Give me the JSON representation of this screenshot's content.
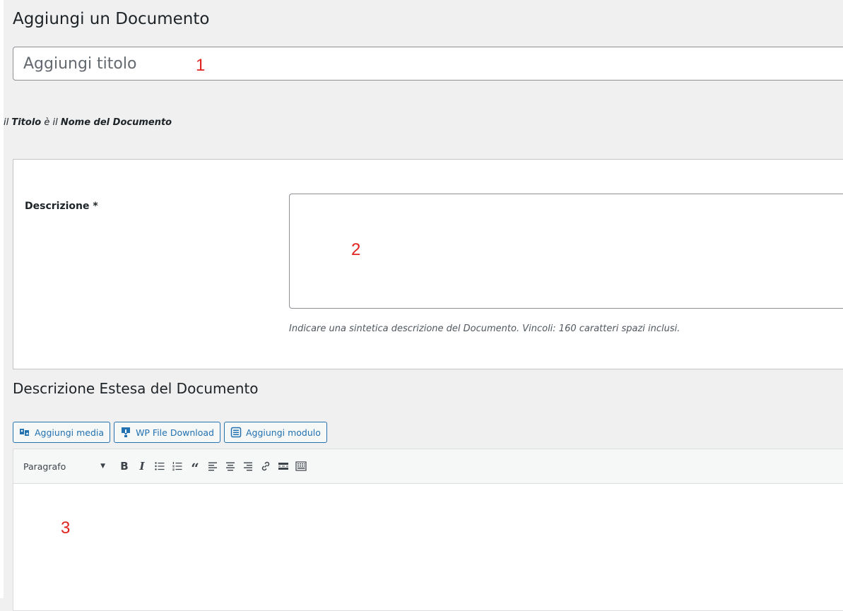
{
  "page": {
    "title": "Aggiungi un Documento"
  },
  "title_field": {
    "value": "",
    "placeholder": "Aggiungi titolo",
    "marker": "1"
  },
  "title_hint": {
    "part1": "il ",
    "bold1": "Titolo",
    "part2": " è il ",
    "bold2": "Nome del Documento"
  },
  "description": {
    "label": "Descrizione *",
    "value": "",
    "marker": "2",
    "help": "Indicare una sintetica descrizione del Documento. Vincoli: 160 caratteri spazi inclusi."
  },
  "extended": {
    "title": "Descrizione Estesa del Documento",
    "buttons": [
      {
        "label": "Aggiungi media",
        "icon": "media-icon"
      },
      {
        "label": "WP File Download",
        "icon": "download-icon"
      },
      {
        "label": "Aggiungi modulo",
        "icon": "form-icon"
      }
    ],
    "format_select": "Paragrafo",
    "toolbar_icons": [
      "bold-icon",
      "italic-icon",
      "bullet-list-icon",
      "numbered-list-icon",
      "blockquote-icon",
      "align-left-icon",
      "align-center-icon",
      "align-right-icon",
      "link-icon",
      "read-more-icon",
      "toolbar-toggle-icon"
    ],
    "toolbar_glyphs": {
      "bold": "B",
      "italic": "I",
      "quote": "“"
    },
    "marker": "3"
  },
  "colors": {
    "accent": "#2271b1",
    "marker": "#e0231e",
    "background": "#f0f0f1"
  }
}
